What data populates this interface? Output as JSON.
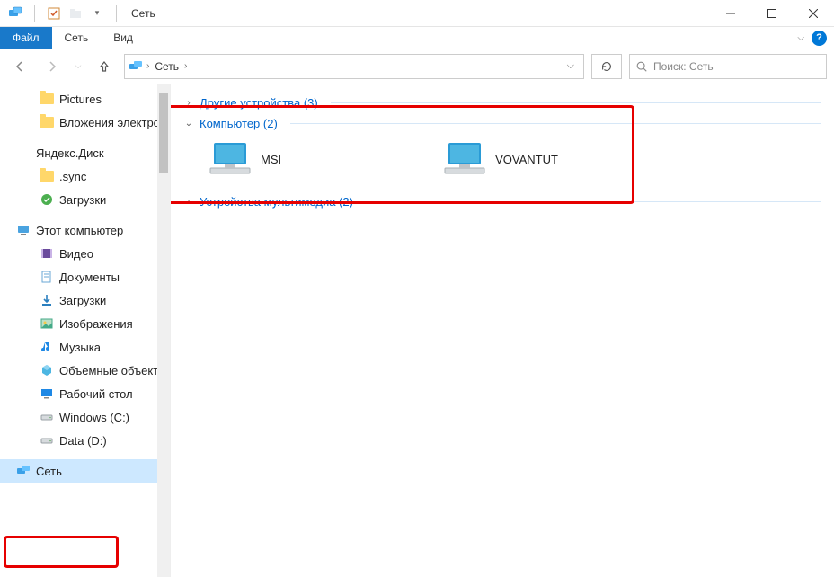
{
  "window": {
    "title": "Сеть"
  },
  "ribbon": {
    "file": "Файл",
    "tabs": [
      "Сеть",
      "Вид"
    ]
  },
  "nav": {
    "crumb": "Сеть"
  },
  "search": {
    "placeholder": "Поиск: Сеть"
  },
  "sidebar": {
    "items": [
      {
        "label": "Pictures",
        "icon": "folder",
        "indent": true
      },
      {
        "label": "Вложения электронной почты",
        "icon": "folder",
        "indent": true
      },
      {
        "gap": true
      },
      {
        "label": "Яндекс.Диск",
        "icon": "yadisk",
        "indent": false,
        "toplevel": true
      },
      {
        "label": ".sync",
        "icon": "folder",
        "indent": true
      },
      {
        "label": "Загрузки",
        "icon": "check-green",
        "indent": true
      },
      {
        "gap": true
      },
      {
        "label": "Этот компьютер",
        "icon": "this-pc",
        "indent": false,
        "toplevel": true
      },
      {
        "label": "Видео",
        "icon": "video",
        "indent": true
      },
      {
        "label": "Документы",
        "icon": "documents",
        "indent": true
      },
      {
        "label": "Загрузки",
        "icon": "downloads",
        "indent": true
      },
      {
        "label": "Изображения",
        "icon": "images",
        "indent": true
      },
      {
        "label": "Музыка",
        "icon": "music",
        "indent": true
      },
      {
        "label": "Объемные объекты",
        "icon": "objects3d",
        "indent": true
      },
      {
        "label": "Рабочий стол",
        "icon": "desktop",
        "indent": true
      },
      {
        "label": "Windows (C:)",
        "icon": "drive",
        "indent": true
      },
      {
        "label": "Data (D:)",
        "icon": "drive",
        "indent": true
      },
      {
        "gap": true
      },
      {
        "label": "Сеть",
        "icon": "network",
        "indent": false,
        "toplevel": true,
        "selected": true
      }
    ]
  },
  "main": {
    "groups": [
      {
        "name": "Другие устройства",
        "count": 3,
        "expanded": false,
        "items": []
      },
      {
        "name": "Компьютер",
        "count": 2,
        "expanded": true,
        "items": [
          {
            "label": "MSI",
            "icon": "pc"
          },
          {
            "label": "VOVANTUT",
            "icon": "pc"
          }
        ]
      },
      {
        "name": "Устройства мультимедиа",
        "count": 2,
        "expanded": false,
        "items": []
      }
    ]
  }
}
